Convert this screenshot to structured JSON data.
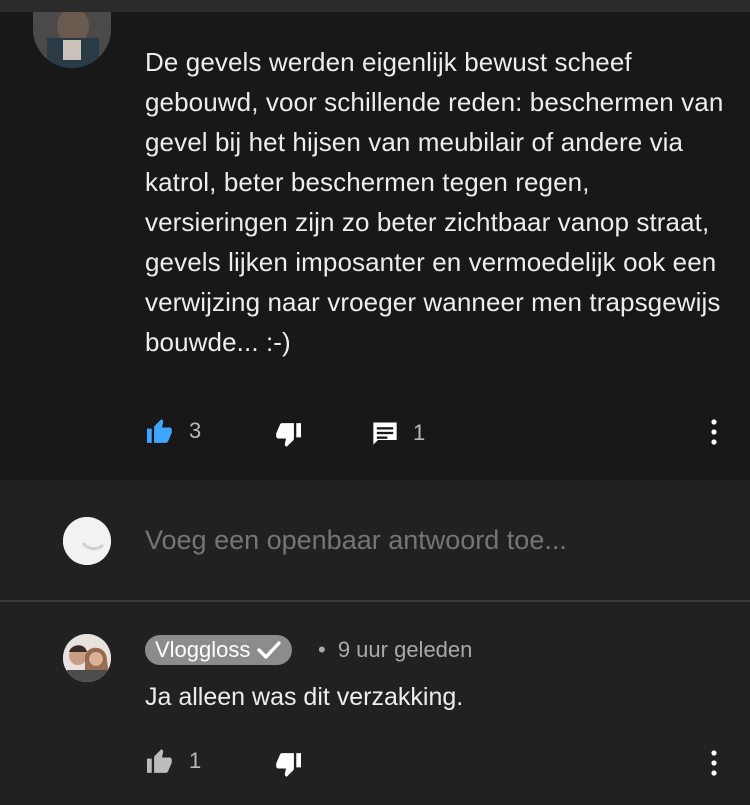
{
  "comment": {
    "text": "De gevels werden eigenlijk bewust scheef gebouwd, voor schillende reden: beschermen van gevel bij het hijsen van meubilair of andere via katrol, beter beschermen tegen regen, versieringen zijn zo beter zichtbaar vanop straat, gevels lijken imposanter en vermoedelijk ook een verwijzing naar vroeger wanneer men trapsgewijs bouwde... :-)",
    "likes": "3",
    "replies": "1",
    "like_icon": "thumbs-up-icon",
    "dislike_icon": "thumbs-down-icon",
    "reply_icon": "comment-icon",
    "more_icon": "more-vertical-icon",
    "liked_color": "#3ea6ff"
  },
  "reply_box": {
    "placeholder": "Voeg een openbaar antwoord toe..."
  },
  "reply": {
    "author": "Vloggloss",
    "verified_icon": "checkmark-icon",
    "separator": "•",
    "time": "9 uur geleden",
    "text": "Ja alleen was dit verzakking.",
    "likes": "1"
  }
}
